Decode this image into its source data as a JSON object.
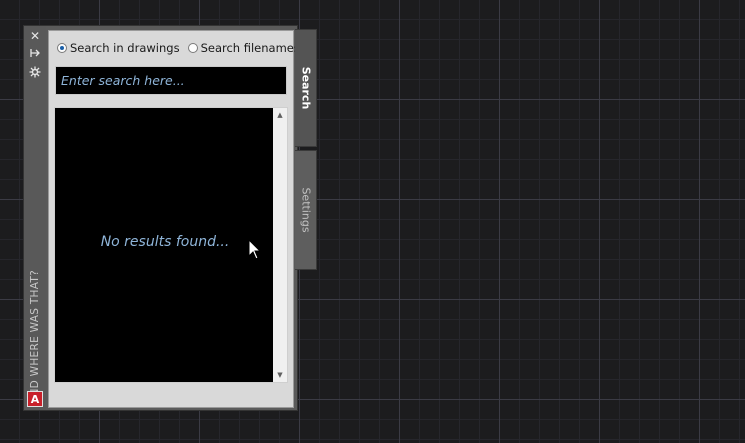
{
  "palette": {
    "title": "AND WHERE WAS THAT?",
    "titlebar_icons": [
      "close-icon",
      "autohide-icon",
      "properties-icon"
    ],
    "logo_letter": "A"
  },
  "search": {
    "options": [
      {
        "label": "Search in drawings",
        "selected": true
      },
      {
        "label": "Search filenames",
        "selected": false
      }
    ],
    "placeholder": "Enter search here...",
    "empty_message": "No results found..."
  },
  "tabs": [
    {
      "label": "Search",
      "active": true
    },
    {
      "label": "Settings",
      "active": false
    }
  ],
  "colors": {
    "canvas_bg": "#1c1c1e",
    "hint_text": "#8fb5d9",
    "logo_red": "#c8202a"
  }
}
